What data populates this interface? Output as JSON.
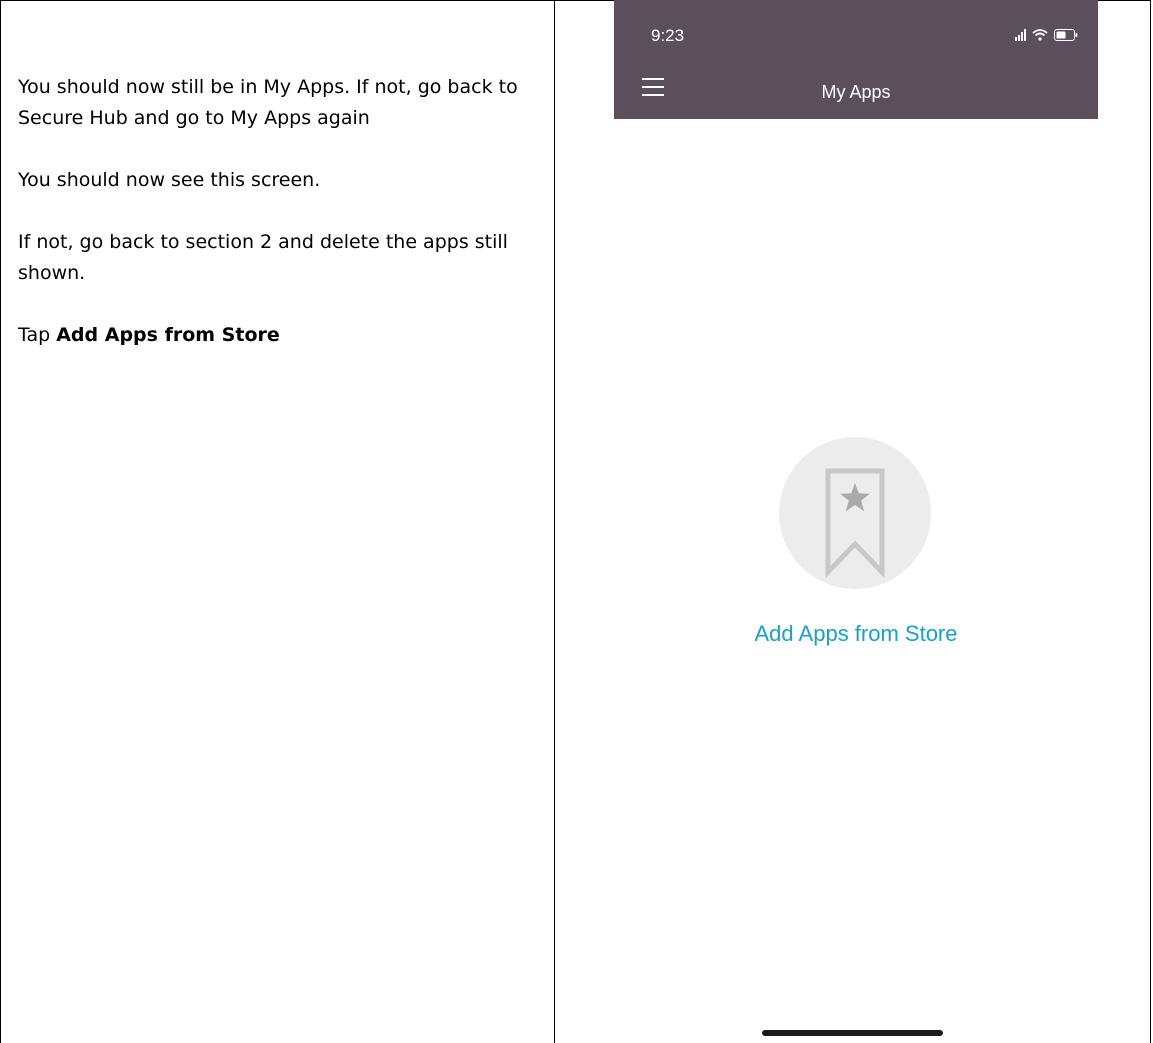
{
  "instructions": {
    "paragraph1": "You should now still be in My Apps. If not, go back to Secure Hub and go to My Apps again",
    "paragraph2": "You should now see this screen.",
    "paragraph3": "If not, go back to section 2 and delete the apps still shown.",
    "tap_prefix": "Tap",
    "tap_target": "Add Apps from Store"
  },
  "phone": {
    "status_bar": {
      "time": "9:23"
    },
    "header": {
      "title": "My Apps"
    },
    "empty_state": {
      "icon": "bookmark-star-icon",
      "link_label": "Add Apps from Store"
    },
    "colors": {
      "header_bg": "#5b4f5c",
      "link": "#1aa1c4",
      "icon_circle": "#ececec",
      "icon_stroke": "#c8c8c8"
    }
  }
}
